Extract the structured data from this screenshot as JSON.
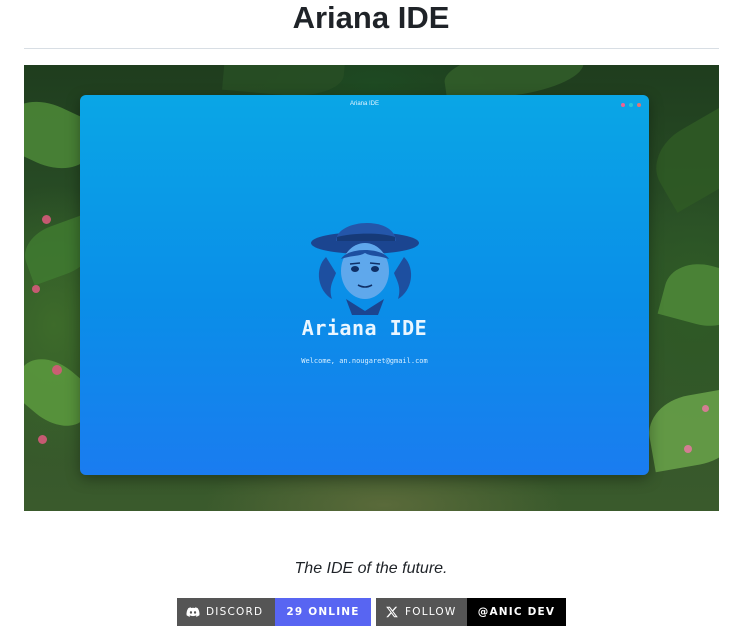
{
  "page": {
    "title": "Ariana IDE",
    "tagline": "The IDE of the future."
  },
  "screenshot": {
    "window_title": "Ariana IDE",
    "app_name": "Ariana IDE",
    "welcome_text": "Welcome, an.nougaret@gmail.com",
    "window_dot_colors": [
      "#f06292",
      "#26c6da",
      "#e57373"
    ]
  },
  "badges": {
    "discord": {
      "label": "DISCORD",
      "value": "29 ONLINE",
      "icon": "discord-icon",
      "label_color": "#555555",
      "value_color": "#5865f2"
    },
    "twitter": {
      "label": "FOLLOW",
      "value": "@ANIC DEV",
      "icon": "x-logo-icon",
      "label_color": "#555555",
      "value_color": "#000000"
    }
  }
}
